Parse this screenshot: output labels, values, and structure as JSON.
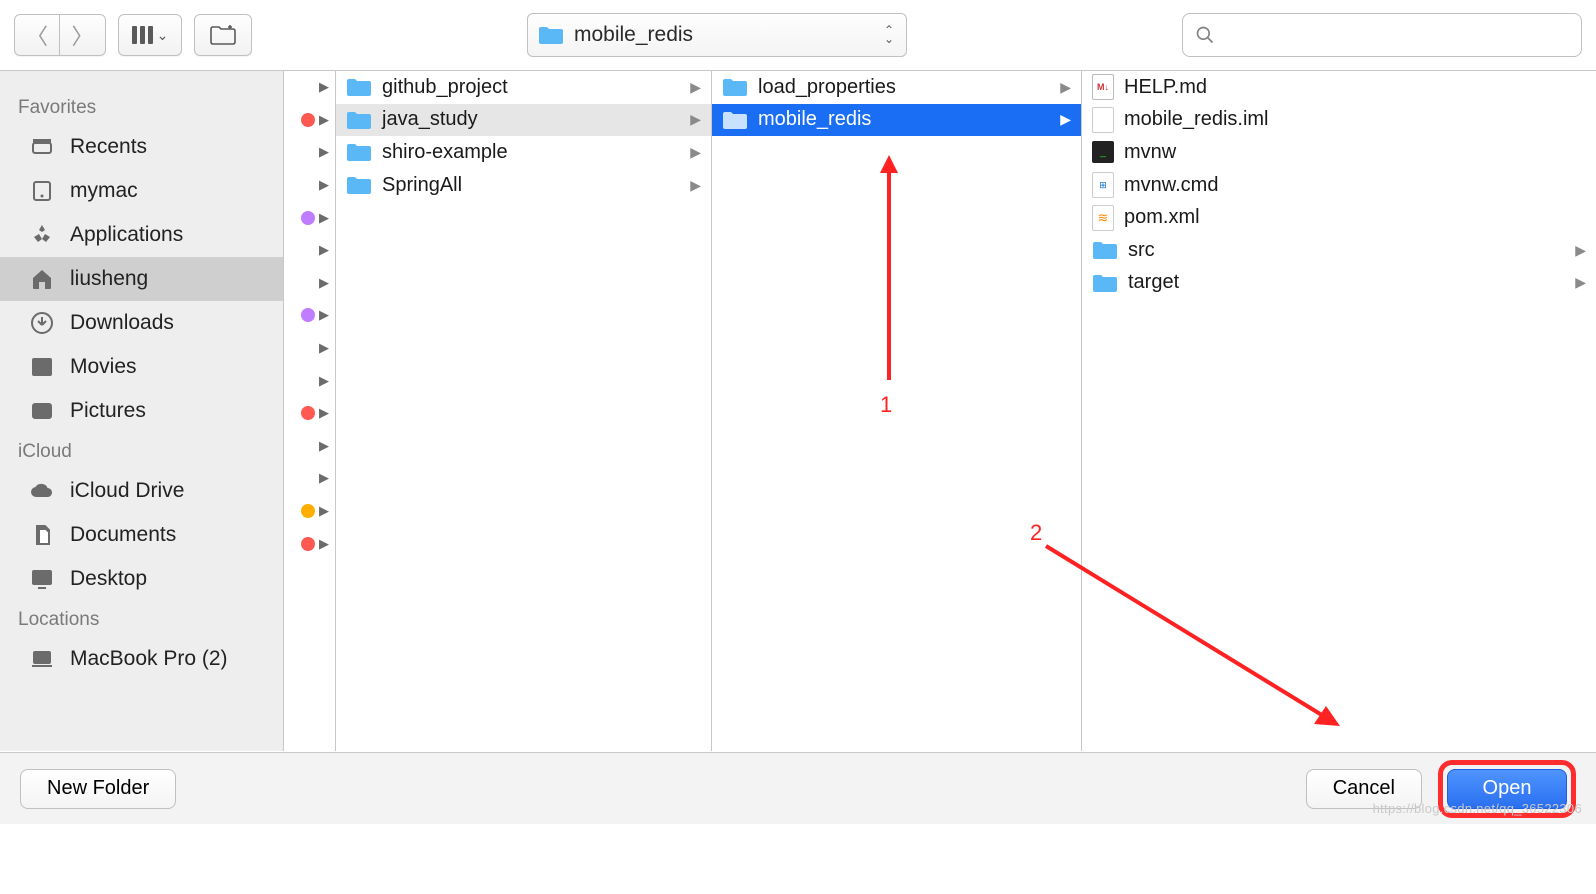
{
  "toolbar": {
    "path_title": "mobile_redis",
    "search_placeholder": ""
  },
  "sidebar": {
    "sections": [
      {
        "title": "Favorites",
        "items": [
          {
            "icon": "recents-icon",
            "label": "Recents"
          },
          {
            "icon": "drive-icon",
            "label": "mymac"
          },
          {
            "icon": "apps-icon",
            "label": "Applications"
          },
          {
            "icon": "home-icon",
            "label": "liusheng",
            "active": true
          },
          {
            "icon": "downloads-icon",
            "label": "Downloads"
          },
          {
            "icon": "movies-icon",
            "label": "Movies"
          },
          {
            "icon": "pictures-icon",
            "label": "Pictures"
          }
        ]
      },
      {
        "title": "iCloud",
        "items": [
          {
            "icon": "icloud-icon",
            "label": "iCloud Drive"
          },
          {
            "icon": "documents-icon",
            "label": "Documents"
          },
          {
            "icon": "desktop-icon",
            "label": "Desktop"
          }
        ]
      },
      {
        "title": "Locations",
        "items": [
          {
            "icon": "laptop-icon",
            "label": "MacBook Pro (2)"
          }
        ]
      }
    ]
  },
  "column0_tags": [
    {
      "color": "",
      "has": false
    },
    {
      "color": "tag-red",
      "has": true
    },
    {
      "color": "",
      "has": false
    },
    {
      "color": "",
      "has": false
    },
    {
      "color": "tag-purple",
      "has": true
    },
    {
      "color": "",
      "has": false
    },
    {
      "color": "",
      "has": false
    },
    {
      "color": "tag-purple",
      "has": true
    },
    {
      "color": "",
      "has": false
    },
    {
      "color": "",
      "has": false
    },
    {
      "color": "tag-red",
      "has": true
    },
    {
      "color": "",
      "has": false
    },
    {
      "color": "",
      "has": false
    },
    {
      "color": "tag-orange",
      "has": true
    },
    {
      "color": "tag-red",
      "has": true
    }
  ],
  "column1": [
    {
      "label": "github_project",
      "folder": true,
      "chev": true
    },
    {
      "label": "java_study",
      "folder": true,
      "chev": true,
      "state": "active-path"
    },
    {
      "label": "shiro-example",
      "folder": true,
      "chev": true
    },
    {
      "label": "SpringAll",
      "folder": true,
      "chev": true
    }
  ],
  "column2": [
    {
      "label": "load_properties",
      "folder": true,
      "chev": true
    },
    {
      "label": "mobile_redis",
      "folder": true,
      "chev": true,
      "state": "selected"
    }
  ],
  "column3": [
    {
      "label": "HELP.md",
      "folder": false,
      "icon": "md"
    },
    {
      "label": "mobile_redis.iml",
      "folder": false,
      "icon": "blank"
    },
    {
      "label": "mvnw",
      "folder": false,
      "icon": "exec"
    },
    {
      "label": "mvnw.cmd",
      "folder": false,
      "icon": "cmd"
    },
    {
      "label": "pom.xml",
      "folder": false,
      "icon": "xml"
    },
    {
      "label": "src",
      "folder": true,
      "chev": true
    },
    {
      "label": "target",
      "folder": true,
      "chev": true
    }
  ],
  "footer": {
    "new_folder": "New Folder",
    "cancel": "Cancel",
    "open": "Open"
  },
  "annotations": {
    "one": "1",
    "two": "2"
  },
  "watermark": "https://blog.csdn.net/qq_36522306"
}
